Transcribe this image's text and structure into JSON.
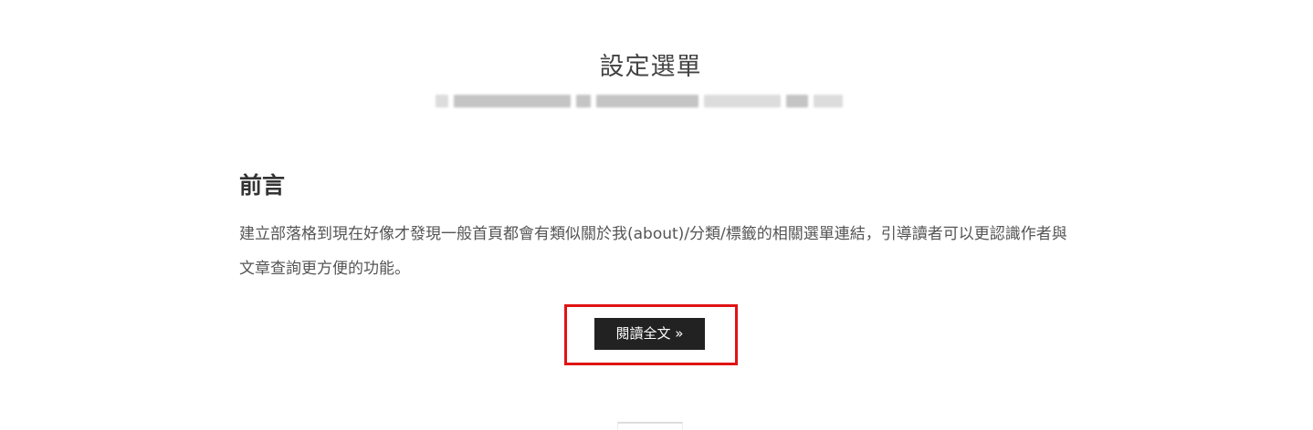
{
  "post": {
    "title": "設定選單",
    "meta_text": "",
    "section_heading": "前言",
    "intro": "建立部落格到現在好像才發現一般首頁都會有類似關於我(about)/分類/標籤的相關選單連結，引導讀者可以更認識作者與文章查詢更方便的功能。",
    "read_more_label": "閱讀全文 »"
  },
  "colors": {
    "highlight_border": "#e01414",
    "button_background": "#222222",
    "button_text": "#ffffff"
  }
}
